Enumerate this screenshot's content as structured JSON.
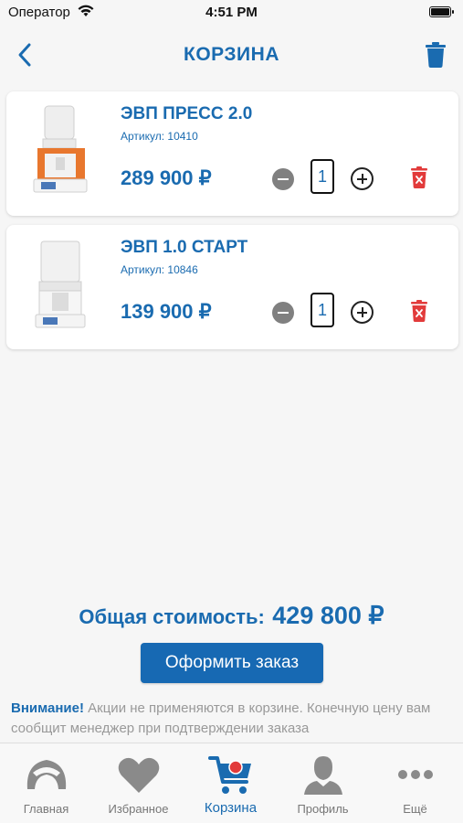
{
  "status_bar": {
    "carrier": "Оператор",
    "time": "4:51 PM"
  },
  "nav": {
    "title": "КОРЗИНА",
    "back_icon": "chevron-left-icon",
    "clear_icon": "trash-icon"
  },
  "cart": {
    "items": [
      {
        "name": "ЭВП ПРЕСС 2.0",
        "sku": "Артикул: 10410",
        "price": "289 900 ₽",
        "quantity": "1"
      },
      {
        "name": "ЭВП 1.0 СТАРТ",
        "sku": "Артикул: 10846",
        "price": "139 900 ₽",
        "quantity": "1"
      }
    ]
  },
  "summary": {
    "total_label": "Общая стоимость:",
    "total_value": "429 800 ₽",
    "order_button": "Оформить заказ"
  },
  "notice": {
    "strong": "Внимание!",
    "text": " Акции не применяются в корзине. Конечную цену вам сообщит менеджер при подтверждении заказа"
  },
  "tabbar": {
    "tabs": [
      {
        "label": "Главная",
        "icon": "home-tooth-icon"
      },
      {
        "label": "Избранное",
        "icon": "heart-icon"
      },
      {
        "label": "Корзина",
        "icon": "cart-icon",
        "active": true
      },
      {
        "label": "Профиль",
        "icon": "profile-icon"
      },
      {
        "label": "Ещё",
        "icon": "more-icon"
      }
    ]
  },
  "colors": {
    "brand": "#1a6bb0",
    "danger": "#e23b3b",
    "inactive": "#8a8a8a"
  }
}
